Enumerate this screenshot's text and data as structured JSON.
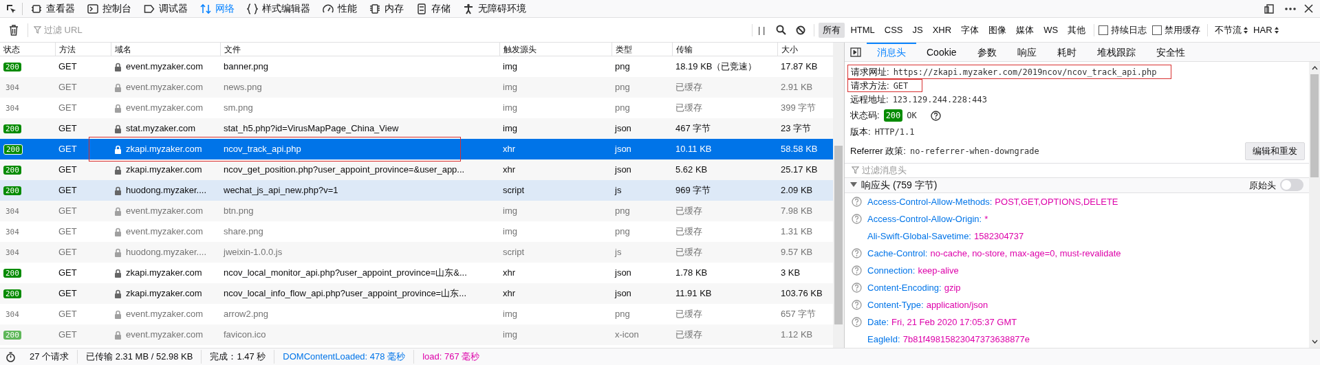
{
  "toolbar": {
    "tools": [
      {
        "label": "查看器",
        "selected": false
      },
      {
        "label": "控制台",
        "selected": false
      },
      {
        "label": "调试器",
        "selected": false
      },
      {
        "label": "网络",
        "selected": true
      },
      {
        "label": "样式编辑器",
        "selected": false
      },
      {
        "label": "性能",
        "selected": false
      },
      {
        "label": "内存",
        "selected": false
      },
      {
        "label": "存储",
        "selected": false
      },
      {
        "label": "无障碍环境",
        "selected": false
      }
    ]
  },
  "filter_bar": {
    "placeholder": "过滤 URL",
    "pause": "| |",
    "types": [
      {
        "label": "所有",
        "selected": true
      },
      {
        "label": "HTML",
        "selected": false
      },
      {
        "label": "CSS",
        "selected": false
      },
      {
        "label": "JS",
        "selected": false
      },
      {
        "label": "XHR",
        "selected": false
      },
      {
        "label": "字体",
        "selected": false
      },
      {
        "label": "图像",
        "selected": false
      },
      {
        "label": "媒体",
        "selected": false
      },
      {
        "label": "WS",
        "selected": false
      },
      {
        "label": "其他",
        "selected": false
      }
    ],
    "checkboxes": [
      {
        "label": "持续日志",
        "checked": false
      },
      {
        "label": "禁用缓存",
        "checked": false
      }
    ],
    "dropdowns": [
      "不节流",
      "HAR"
    ]
  },
  "table": {
    "columns": [
      "状态",
      "方法",
      "域名",
      "文件",
      "触发源头",
      "类型",
      "传输",
      "大小"
    ],
    "rows": [
      {
        "status": "200",
        "kind": "solid",
        "method": "GET",
        "domain": "event.myzaker.com",
        "file": "banner.png",
        "cause": "img",
        "type": "png",
        "transferred": "18.19 KB（已竞速）",
        "size": "17.87 KB",
        "dimmed": false,
        "selected": false,
        "hovered": false
      },
      {
        "status": "304",
        "kind": "plain",
        "method": "GET",
        "domain": "event.myzaker.com",
        "file": "news.png",
        "cause": "img",
        "type": "png",
        "transferred": "已缓存",
        "size": "2.91 KB",
        "dimmed": true,
        "selected": false,
        "hovered": false
      },
      {
        "status": "304",
        "kind": "plain",
        "method": "GET",
        "domain": "event.myzaker.com",
        "file": "sm.png",
        "cause": "img",
        "type": "png",
        "transferred": "已缓存",
        "size": "399 字节",
        "dimmed": true,
        "selected": false,
        "hovered": false
      },
      {
        "status": "200",
        "kind": "solid",
        "method": "GET",
        "domain": "stat.myzaker.com",
        "file": "stat_h5.php?id=VirusMapPage_China_View",
        "cause": "img",
        "type": "json",
        "transferred": "467 字节",
        "size": "23 字节",
        "dimmed": false,
        "selected": false,
        "hovered": false
      },
      {
        "status": "200",
        "kind": "solid",
        "method": "GET",
        "domain": "zkapi.myzaker.com",
        "file": "ncov_track_api.php",
        "cause": "xhr",
        "type": "json",
        "transferred": "10.11 KB",
        "size": "58.58 KB",
        "dimmed": false,
        "selected": true,
        "hovered": false
      },
      {
        "status": "200",
        "kind": "solid",
        "method": "GET",
        "domain": "zkapi.myzaker.com",
        "file": "ncov_get_position.php?user_appoint_province=&user_app...",
        "cause": "xhr",
        "type": "json",
        "transferred": "5.62 KB",
        "size": "25.17 KB",
        "dimmed": false,
        "selected": false,
        "hovered": false
      },
      {
        "status": "200",
        "kind": "solid",
        "method": "GET",
        "domain": "huodong.myzaker....",
        "file": "wechat_js_api_new.php?v=1",
        "cause": "script",
        "type": "js",
        "transferred": "969 字节",
        "size": "2.09 KB",
        "dimmed": false,
        "selected": false,
        "hovered": true
      },
      {
        "status": "304",
        "kind": "plain",
        "method": "GET",
        "domain": "event.myzaker.com",
        "file": "btn.png",
        "cause": "img",
        "type": "png",
        "transferred": "已缓存",
        "size": "7.98 KB",
        "dimmed": true,
        "selected": false,
        "hovered": false
      },
      {
        "status": "304",
        "kind": "plain",
        "method": "GET",
        "domain": "event.myzaker.com",
        "file": "share.png",
        "cause": "img",
        "type": "png",
        "transferred": "已缓存",
        "size": "1.31 KB",
        "dimmed": true,
        "selected": false,
        "hovered": false
      },
      {
        "status": "304",
        "kind": "plain",
        "method": "GET",
        "domain": "huodong.myzaker....",
        "file": "jweixin-1.0.0.js",
        "cause": "script",
        "type": "js",
        "transferred": "已缓存",
        "size": "9.57 KB",
        "dimmed": true,
        "selected": false,
        "hovered": false
      },
      {
        "status": "200",
        "kind": "solid",
        "method": "GET",
        "domain": "zkapi.myzaker.com",
        "file": "ncov_local_monitor_api.php?user_appoint_province=山东&...",
        "cause": "xhr",
        "type": "json",
        "transferred": "1.78 KB",
        "size": "3 KB",
        "dimmed": false,
        "selected": false,
        "hovered": false
      },
      {
        "status": "200",
        "kind": "solid",
        "method": "GET",
        "domain": "zkapi.myzaker.com",
        "file": "ncov_local_info_flow_api.php?user_appoint_province=山东...",
        "cause": "xhr",
        "type": "json",
        "transferred": "11.91 KB",
        "size": "103.76 KB",
        "dimmed": false,
        "selected": false,
        "hovered": false
      },
      {
        "status": "304",
        "kind": "plain",
        "method": "GET",
        "domain": "event.myzaker.com",
        "file": "arrow2.png",
        "cause": "img",
        "type": "png",
        "transferred": "已缓存",
        "size": "657 字节",
        "dimmed": true,
        "selected": false,
        "hovered": false
      },
      {
        "status": "200",
        "kind": "light",
        "method": "GET",
        "domain": "event.myzaker.com",
        "file": "favicon.ico",
        "cause": "img",
        "type": "x-icon",
        "transferred": "已缓存",
        "size": "1.12 KB",
        "dimmed": true,
        "selected": false,
        "hovered": false
      }
    ]
  },
  "status_bar": {
    "requests": "27 个请求",
    "transferred": "已传输 2.31 MB / 52.98 KB",
    "finish": "完成：1.47 秒",
    "dom_content_loaded": "DOMContentLoaded: 478 毫秒",
    "load": "load: 767 毫秒"
  },
  "details": {
    "tabs": [
      {
        "label": "消息头",
        "selected": true
      },
      {
        "label": "Cookie",
        "selected": false
      },
      {
        "label": "参数",
        "selected": false
      },
      {
        "label": "响应",
        "selected": false
      },
      {
        "label": "耗时",
        "selected": false
      },
      {
        "label": "堆栈跟踪",
        "selected": false
      },
      {
        "label": "安全性",
        "selected": false
      }
    ],
    "summary": [
      {
        "kind": "text",
        "label": "请求网址:",
        "value": "https://zkapi.myzaker.com/2019ncov/ncov_track_api.php",
        "highlighted": true
      },
      {
        "kind": "text",
        "label": "请求方法:",
        "value": "GET",
        "highlighted": true
      },
      {
        "kind": "text",
        "label": "远程地址:",
        "value": "123.129.244.228:443",
        "highlighted": false
      },
      {
        "kind": "status",
        "label": "状态码:",
        "badge": "200",
        "value": "OK",
        "highlighted": false
      },
      {
        "kind": "text",
        "label": "版本:",
        "value": "HTTP/1.1",
        "highlighted": false
      },
      {
        "kind": "button",
        "label": "Referrer 政策:",
        "value": "no-referrer-when-downgrade",
        "button": "编辑和重发",
        "highlighted": false
      }
    ],
    "filter_placeholder": "过滤消息头",
    "response_headers": {
      "title": "响应头 (759 字节)",
      "expanded": true,
      "raw_label": "原始头",
      "raw_on": false,
      "headers": [
        {
          "name": "Access-Control-Allow-Methods:",
          "value": "POST,GET,OPTIONS,DELETE",
          "help": true
        },
        {
          "name": "Access-Control-Allow-Origin:",
          "value": "*",
          "help": true
        },
        {
          "name": "Ali-Swift-Global-Savetime:",
          "value": "1582304737",
          "help": false
        },
        {
          "name": "Cache-Control:",
          "value": "no-cache, no-store, max-age=0, must-revalidate",
          "help": true
        },
        {
          "name": "Connection:",
          "value": "keep-alive",
          "help": true
        },
        {
          "name": "Content-Encoding:",
          "value": "gzip",
          "help": true
        },
        {
          "name": "Content-Type:",
          "value": "application/json",
          "help": true
        },
        {
          "name": "Date:",
          "value": "Fri, 21 Feb 2020 17:05:37 GMT",
          "help": true
        },
        {
          "name": "EagleId:",
          "value": "7b81f49815823047373638877e",
          "help": false
        }
      ]
    }
  }
}
